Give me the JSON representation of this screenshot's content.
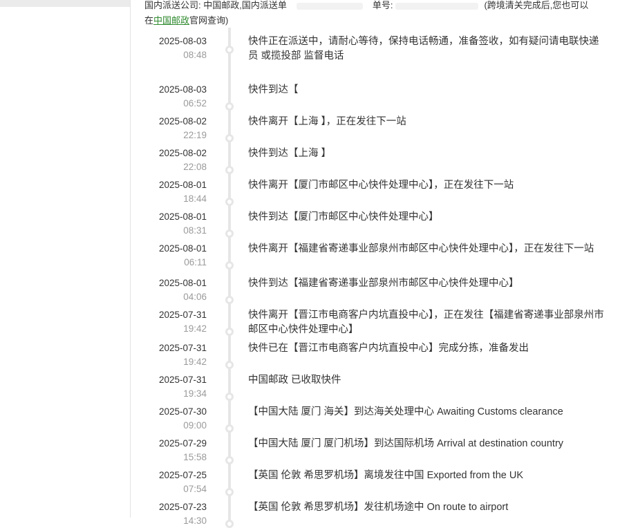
{
  "notice": {
    "prefix": "国内派送公司: 中国邮政,国内派送单",
    "middle": "单号:",
    "suffix": "(跨境清关完成后,您也可以",
    "line2_link": "中国邮政",
    "line2_rest": "官网查询)"
  },
  "events": [
    {
      "date": "2025-08-03",
      "time": "08:48",
      "text": "快件正在派送中，请耐心等待，保持电话畅通，准备签收，如有疑问请电联快递员                                                                或揽投部                                              监督电话"
    },
    {
      "date": "2025-08-03",
      "time": "06:52",
      "text": "快件到达【"
    },
    {
      "date": "2025-08-02",
      "time": "22:19",
      "text": "快件离开【上海                                        】，正在发往下一站"
    },
    {
      "date": "2025-08-02",
      "time": "22:08",
      "text": "快件到达【上海                              】"
    },
    {
      "date": "2025-08-01",
      "time": "18:44",
      "text": "快件离开【厦门市邮区中心快件处理中心】，正在发往下一站"
    },
    {
      "date": "2025-08-01",
      "time": "08:31",
      "text": "快件到达【厦门市邮区中心快件处理中心】"
    },
    {
      "date": "2025-08-01",
      "time": "06:11",
      "text": "快件离开【福建省寄递事业部泉州市邮区中心快件处理中心】，正在发往下一站"
    },
    {
      "date": "2025-08-01",
      "time": "04:06",
      "text": "快件到达【福建省寄递事业部泉州市邮区中心快件处理中心】"
    },
    {
      "date": "2025-07-31",
      "time": "19:42",
      "text": "快件离开【晋江市电商客户内坑直投中心】，正在发往【福建省寄递事业部泉州市邮区中心快件处理中心】"
    },
    {
      "date": "2025-07-31",
      "time": "19:42",
      "text": "快件已在【晋江市电商客户内坑直投中心】完成分拣，准备发出"
    },
    {
      "date": "2025-07-31",
      "time": "19:34",
      "text": "中国邮政 已收取快件"
    },
    {
      "date": "2025-07-30",
      "time": "09:00",
      "text": "【中国大陆 厦门 海关】到达海关处理中心 Awaiting Customs clearance"
    },
    {
      "date": "2025-07-29",
      "time": "15:58",
      "text": "【中国大陆 厦门 厦门机场】到达国际机场 Arrival at destination country"
    },
    {
      "date": "2025-07-25",
      "time": "07:54",
      "text": "【英国 伦敦 希思罗机场】离境发往中国 Exported from the UK"
    },
    {
      "date": "2025-07-23",
      "time": "14:30",
      "text": "【英国 伦敦 希思罗机场】发往机场途中 On route to airport"
    }
  ]
}
